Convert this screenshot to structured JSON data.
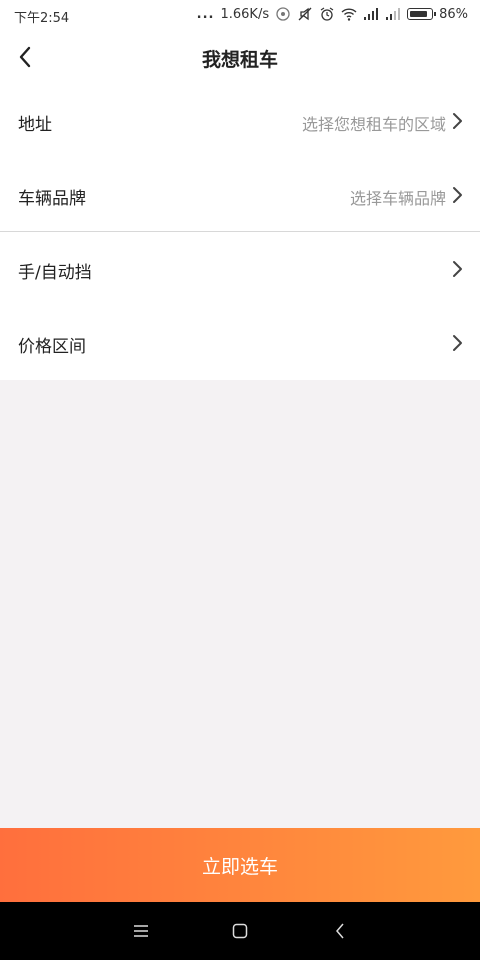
{
  "status_bar": {
    "time": "下午2:54",
    "dots": "...",
    "speed": "1.66K/s",
    "battery": "86%"
  },
  "nav": {
    "title": "我想租车"
  },
  "form": {
    "rows": [
      {
        "label": "地址",
        "value": "选择您想租车的区域"
      },
      {
        "label": "车辆品牌",
        "value": "选择车辆品牌"
      },
      {
        "label": "手/自动挡",
        "value": ""
      },
      {
        "label": "价格区间",
        "value": ""
      }
    ]
  },
  "cta": {
    "label": "立即选车"
  },
  "colors": {
    "accent_start": "#ff6f3d",
    "accent_end": "#ff9a3d",
    "background": "#f4f2f3",
    "placeholder": "#999999"
  },
  "icons": {
    "back": "back-arrow-icon",
    "chevron": "chevron-right-icon",
    "menu": "menu-icon",
    "home": "home-icon",
    "sys_back": "back-icon"
  }
}
